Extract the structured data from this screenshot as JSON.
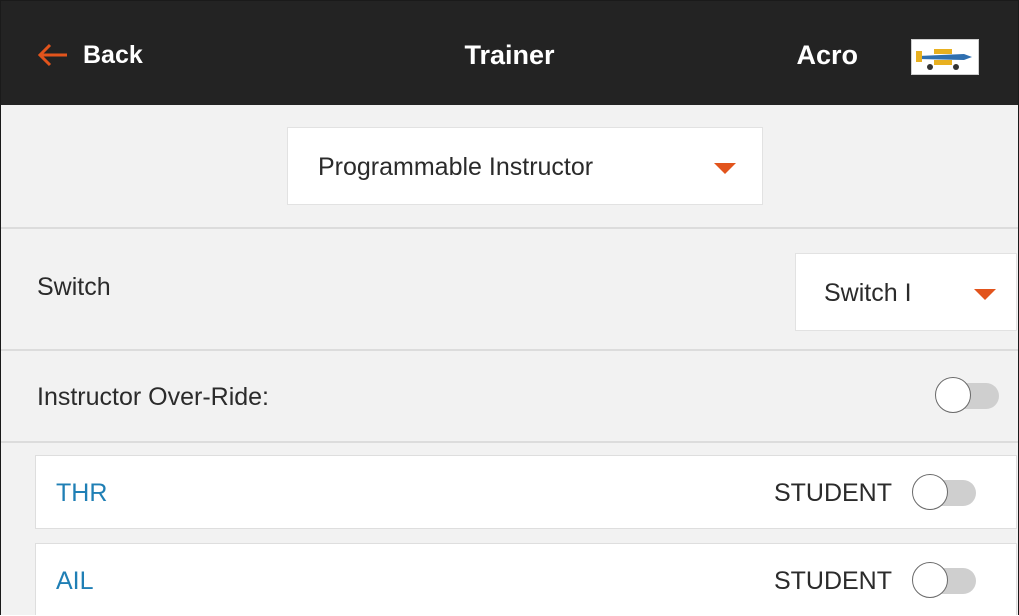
{
  "header": {
    "back_label": "Back",
    "title": "Trainer",
    "model_name": "Acro",
    "back_icon": "arrow-left-icon",
    "model_icon": "airplane-thumbnail-icon",
    "accent_color": "#e2541c",
    "bar_color": "#232323"
  },
  "mode": {
    "selected": "Programmable Instructor"
  },
  "switch_setting": {
    "label": "Switch",
    "selected": "Switch I"
  },
  "override": {
    "label": "Instructor Over-Ride:",
    "enabled": false
  },
  "channels": [
    {
      "name": "THR",
      "status": "STUDENT",
      "enabled": false
    },
    {
      "name": "AIL",
      "status": "STUDENT",
      "enabled": false
    }
  ],
  "colors": {
    "channel_name": "#1f7fb5",
    "caret": "#e2541c"
  }
}
